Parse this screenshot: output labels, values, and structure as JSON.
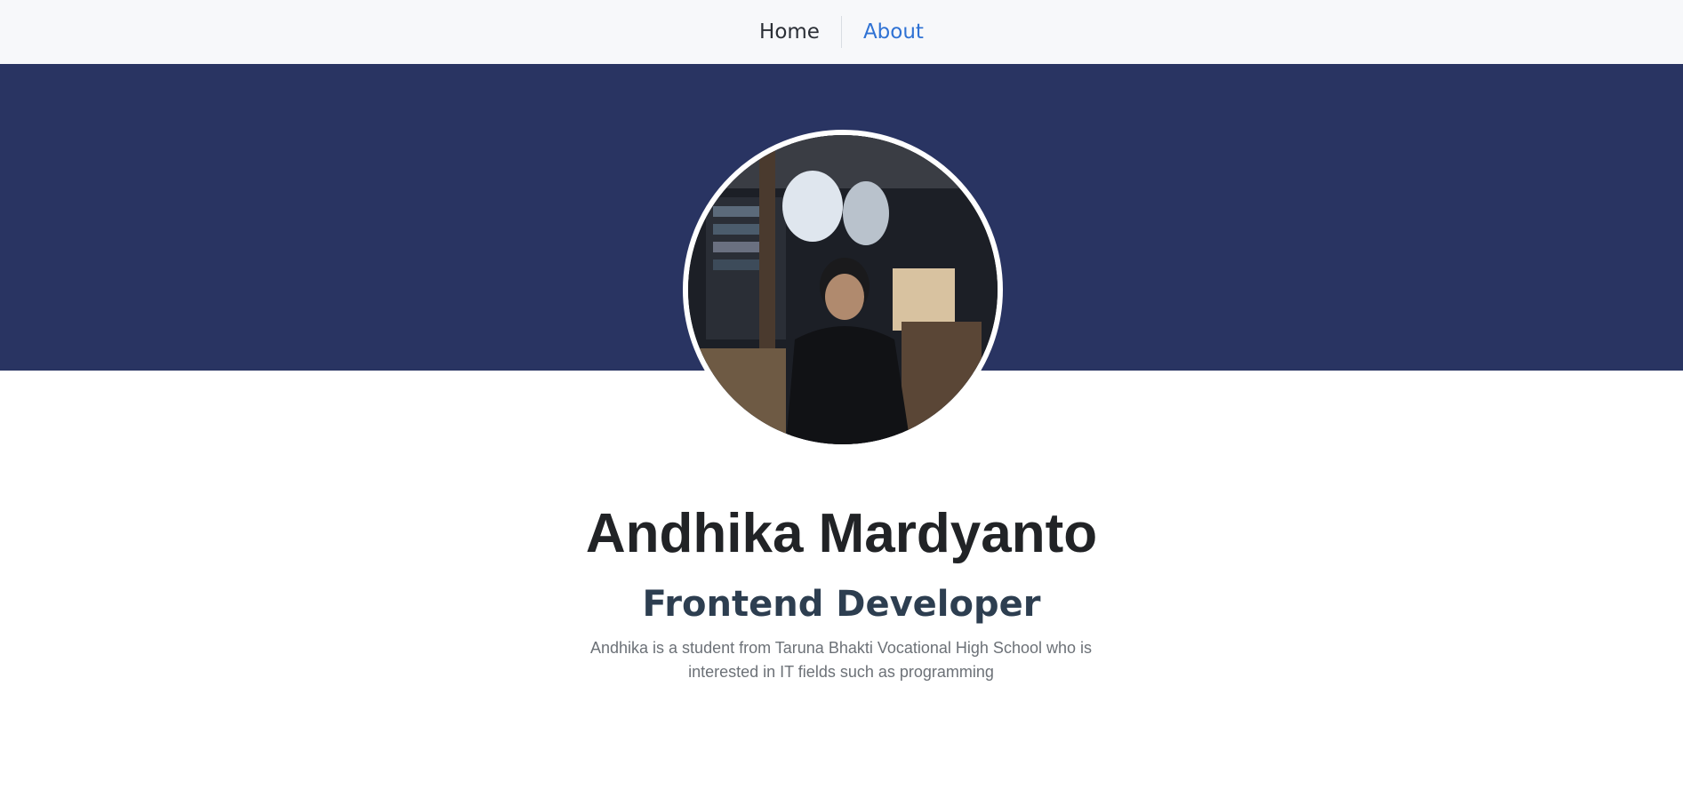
{
  "nav": {
    "home_label": "Home",
    "about_label": "About"
  },
  "profile": {
    "name": "Andhika Mardyanto",
    "role": "Frontend Developer",
    "bio": "Andhika is a student from Taruna Bhakti Vocational High School who is interested in IT fields such as programming"
  },
  "colors": {
    "navbar_bg": "#f7f8fa",
    "hero_bg": "#293462",
    "active_link": "#2f72d4",
    "title_text": "#212326",
    "role_text": "#2d3e50",
    "bio_text": "#6c7177"
  }
}
